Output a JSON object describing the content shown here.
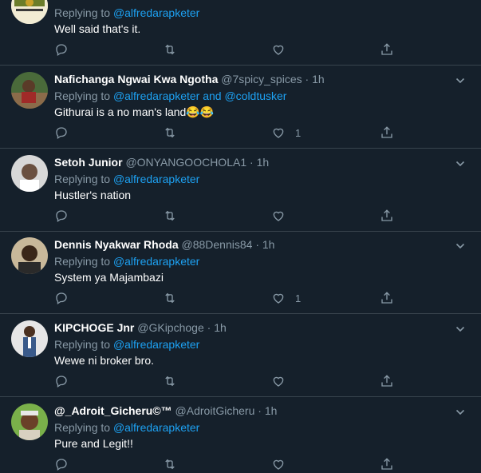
{
  "colors": {
    "background": "#15202b",
    "link": "#1da1f2",
    "muted": "#8899a6",
    "divider": "#38444d"
  },
  "tweets": [
    {
      "name": "",
      "handle": "",
      "time": "",
      "replying_prefix": "Replying to ",
      "replying_to": "@alfredarapketer",
      "text": "Well said that's it.",
      "likes": ""
    },
    {
      "name": "Nafichanga Ngwai Kwa Ngotha",
      "handle": "@7spicy_spices",
      "time": "1h",
      "replying_prefix": "Replying to ",
      "replying_to": "@alfredarapketer and @coldtusker",
      "text": "Githurai is a no man's land😂😂",
      "likes": "1"
    },
    {
      "name": "Setoh Junior",
      "handle": "@ONYANGOOCHOLA1",
      "time": "1h",
      "replying_prefix": "Replying to ",
      "replying_to": "@alfredarapketer",
      "text": "Hustler's nation",
      "likes": ""
    },
    {
      "name": "Dennis Nyakwar Rhoda",
      "handle": "@88Dennis84",
      "time": "1h",
      "replying_prefix": "Replying to ",
      "replying_to": "@alfredarapketer",
      "text": "System ya Majambazi",
      "likes": "1"
    },
    {
      "name": "KIPCHOGE Jnr",
      "handle": "@GKipchoge",
      "time": "1h",
      "replying_prefix": "Replying to ",
      "replying_to": "@alfredarapketer",
      "text": "Wewe ni broker bro.",
      "likes": ""
    },
    {
      "name": "@_Adroit_Gicheru©™",
      "handle": "@AdroitGicheru",
      "time": "1h",
      "replying_prefix": "Replying to ",
      "replying_to": "@alfredarapketer",
      "text": "Pure and Legit!!",
      "likes": ""
    }
  ],
  "icons": {
    "reply": "reply-icon",
    "retweet": "retweet-icon",
    "like": "like-icon",
    "share": "share-icon",
    "more": "chevron-down-icon"
  },
  "separator": "·"
}
